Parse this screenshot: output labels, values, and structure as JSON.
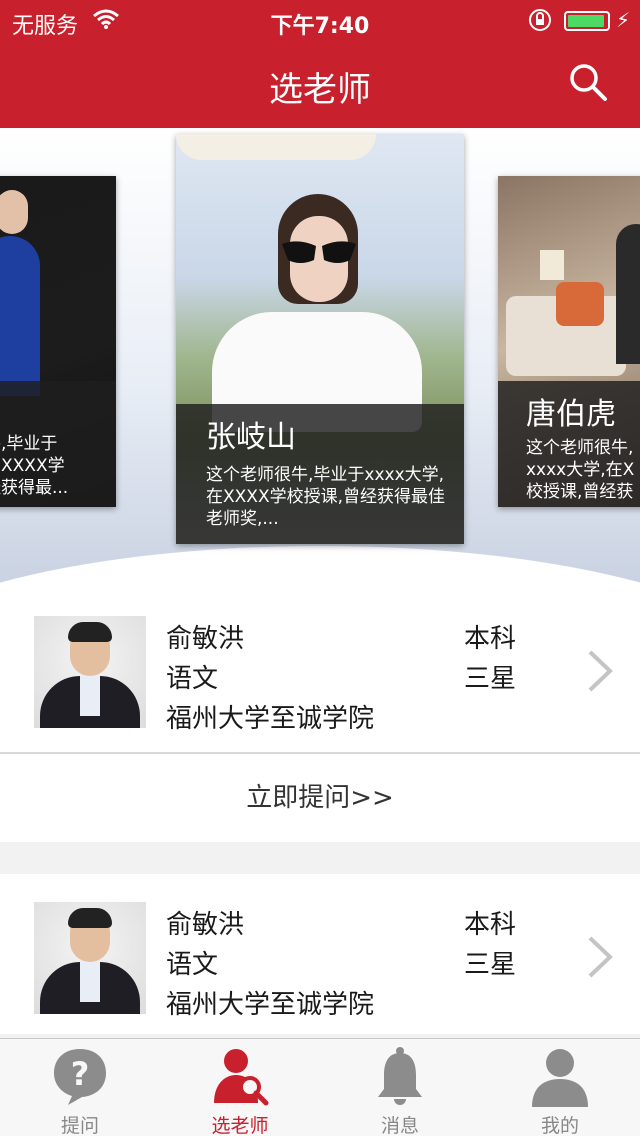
{
  "status_bar": {
    "carrier": "无服务",
    "time": "下午7:40"
  },
  "nav": {
    "title": "选老师"
  },
  "carousel": [
    {
      "name": "",
      "desc": "牛,毕业于\n在XXXX学\n经获得最..."
    },
    {
      "name": "张岐山",
      "desc": "这个老师很牛,毕业于xxxx大学,在XXXX学校授课,曾经获得最佳老师奖,..."
    },
    {
      "name": "唐伯虎",
      "desc": "这个老师很牛,\nxxxx大学,在X\n校授课,曾经获"
    }
  ],
  "teachers": [
    {
      "name": "俞敏洪",
      "subject": "语文",
      "school": "福州大学至诚学院",
      "degree": "本科",
      "rank": "三星",
      "ask_label": "立即提问>>"
    },
    {
      "name": "俞敏洪",
      "subject": "语文",
      "school": "福州大学至诚学院",
      "degree": "本科",
      "rank": "三星"
    }
  ],
  "tabbar": [
    {
      "label": "提问",
      "icon": "question-bubble-icon"
    },
    {
      "label": "选老师",
      "icon": "teacher-search-icon",
      "active": true
    },
    {
      "label": "消息",
      "icon": "bell-icon"
    },
    {
      "label": "我的",
      "icon": "user-icon"
    }
  ],
  "colors": {
    "accent": "#c8202c",
    "battery": "#4cd964",
    "tab_inactive": "#888888"
  }
}
